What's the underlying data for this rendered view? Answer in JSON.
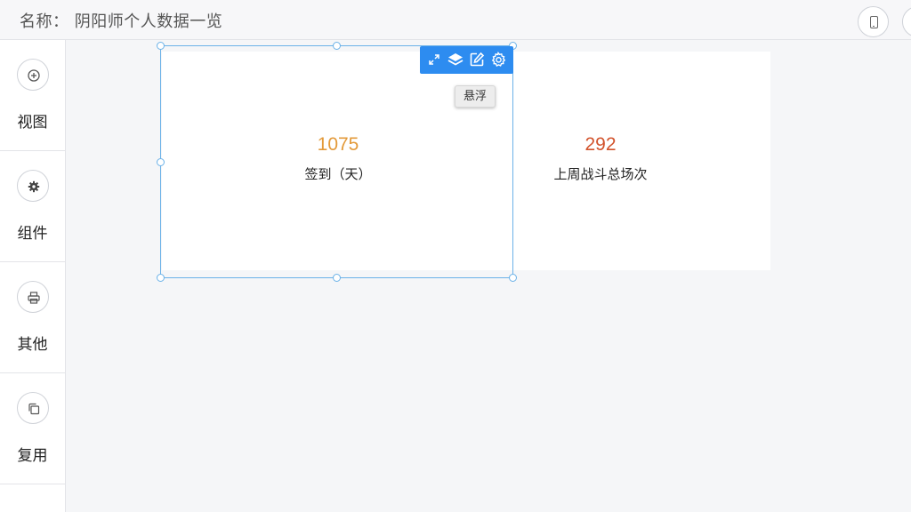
{
  "header": {
    "title": "名称：  阴阳师个人数据一览",
    "phone_preview_icon": "phone-icon"
  },
  "sidebar": {
    "items": [
      {
        "label": "视图",
        "icon": "plus-circle-icon"
      },
      {
        "label": "组件",
        "icon": "gear-icon"
      },
      {
        "label": "其他",
        "icon": "printer-icon"
      },
      {
        "label": "复用",
        "icon": "copy-icon"
      }
    ]
  },
  "canvas": {
    "stats": [
      {
        "value": "1075",
        "label": "签到（天）",
        "color": "#e39a3a"
      },
      {
        "value": "292",
        "label": "上周战斗总场次",
        "color": "#d2532c"
      }
    ],
    "toolbar": {
      "icons": [
        "expand-icon",
        "layers-icon",
        "edit-icon",
        "settings-icon"
      ],
      "color": "#2d8cf0"
    },
    "tooltip": "悬浮",
    "selection_color": "#6bb2e8"
  }
}
